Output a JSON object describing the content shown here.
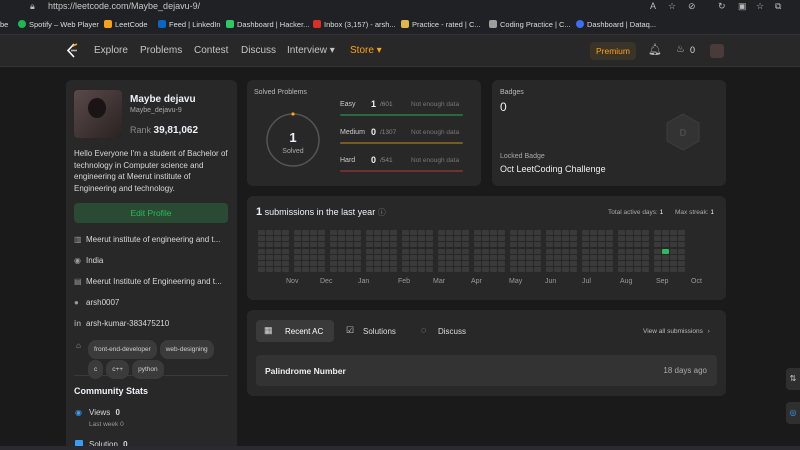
{
  "browser": {
    "url": "https://leetcode.com/Maybe_dejavu-9/",
    "bookmarks": [
      {
        "label": "be",
        "color": "#888"
      },
      {
        "label": "Spotify – Web Player",
        "color": "#1db954"
      },
      {
        "label": "LeetCode",
        "color": "#f89f1b"
      },
      {
        "label": "Feed | LinkedIn",
        "color": "#0a66c2"
      },
      {
        "label": "Dashboard | Hacker...",
        "color": "#2ec866"
      },
      {
        "label": "Inbox (3,157) - arsh...",
        "color": "#d93025"
      },
      {
        "label": "Practice - rated | C...",
        "color": "#e0b84a"
      },
      {
        "label": "Coding Practice | C...",
        "color": "#9e9e9e"
      },
      {
        "label": "Dashboard | Dataq...",
        "color": "#3b6ef0"
      }
    ]
  },
  "nav": {
    "items": [
      "Explore",
      "Problems",
      "Contest",
      "Discuss",
      "Interview ▾",
      "Store ▾"
    ],
    "premium": "Premium",
    "streak": "0",
    "accent": "#ffa116"
  },
  "profile": {
    "name": "Maybe dejavu",
    "username": "Maybe_dejavu-9",
    "rank_label": "Rank",
    "rank": "39,81,062",
    "bio": "Hello Everyone I'm a student of Bachelor of technology in Computer science and engineering at Meerut institute of Engineering and technology.",
    "edit_button": "Edit Profile",
    "info": [
      {
        "icon": "building-icon",
        "glyph": "▥",
        "text": "Meerut institute of engineering and t..."
      },
      {
        "icon": "location-icon",
        "glyph": "◉",
        "text": "India"
      },
      {
        "icon": "school-icon",
        "glyph": "▤",
        "text": "Meerut Institute of Engineering and t..."
      },
      {
        "icon": "github-icon",
        "glyph": "●",
        "text": "arsh0007"
      },
      {
        "icon": "linkedin-icon",
        "glyph": "in",
        "text": "arsh-kumar-383475210"
      }
    ],
    "tags": [
      "front-end-developer",
      "web-designing",
      "c",
      "c++",
      "python"
    ],
    "community_title": "Community Stats",
    "views_label": "Views",
    "views_value": "0",
    "last_week_label": "Last week",
    "last_week_value": "0",
    "solution_label": "Solution",
    "solution_value": "0"
  },
  "solved": {
    "title": "Solved Problems",
    "total": "1",
    "total_label": "Solved",
    "rows": [
      {
        "label": "Easy",
        "count": "1",
        "total": "/601",
        "note": "Not enough data",
        "color": "#2cbb5d"
      },
      {
        "label": "Medium",
        "count": "0",
        "total": "/1307",
        "note": "Not enough data",
        "color": "#ffc01e"
      },
      {
        "label": "Hard",
        "count": "0",
        "total": "/541",
        "note": "Not enough data",
        "color": "#ef4743"
      }
    ]
  },
  "badges": {
    "title": "Badges",
    "count": "0",
    "locked_label": "Locked Badge",
    "locked_name": "Oct LeetCoding Challenge"
  },
  "submissions": {
    "count": "1",
    "text": "submissions in the last year",
    "active_label": "Total active days:",
    "active_value": "1",
    "streak_label": "Max streak:",
    "streak_value": "1",
    "months": [
      "Nov",
      "Dec",
      "Jan",
      "Feb",
      "Mar",
      "Apr",
      "May",
      "Jun",
      "Jul",
      "Aug",
      "Sep",
      "Oct"
    ]
  },
  "recent": {
    "tabs": [
      "Recent AC",
      "Solutions",
      "Discuss"
    ],
    "view_all": "View all submissions",
    "items": [
      {
        "title": "Palindrome Number",
        "time": "18 days ago"
      }
    ]
  }
}
